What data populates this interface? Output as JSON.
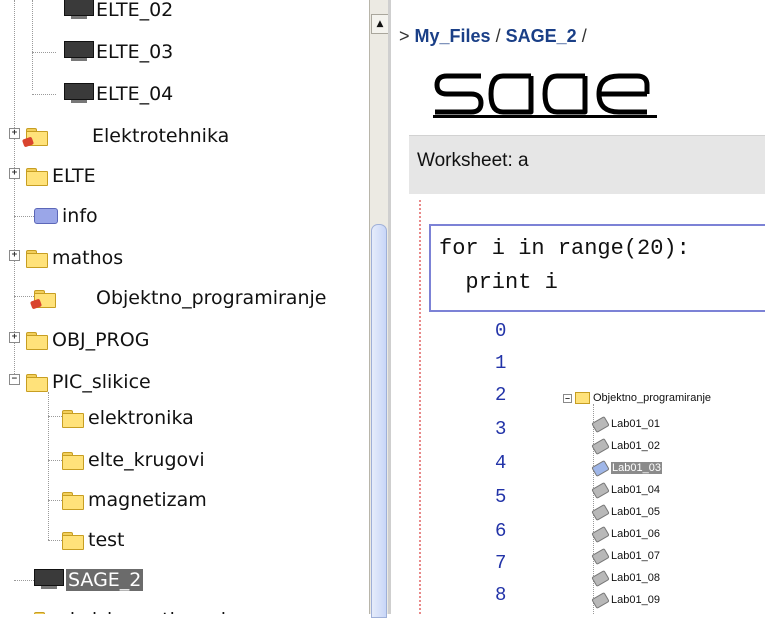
{
  "tree": {
    "items": [
      {
        "label": "ELTE_02",
        "icon": "monitor-icon"
      },
      {
        "label": "ELTE_03",
        "icon": "monitor-icon"
      },
      {
        "label": "ELTE_04",
        "icon": "monitor-icon"
      },
      {
        "label": "Elektrotehnika",
        "icon": "special-folder-icon",
        "expander": "+"
      },
      {
        "label": "ELTE",
        "icon": "folder-icon",
        "expander": "+"
      },
      {
        "label": "info",
        "icon": "info-icon"
      },
      {
        "label": "mathos",
        "icon": "folder-icon",
        "expander": "+"
      },
      {
        "label": "Objektno_programiranje",
        "icon": "special-folder-icon"
      },
      {
        "label": "OBJ_PROG",
        "icon": "folder-icon",
        "expander": "+"
      },
      {
        "label": "PIC_slikice",
        "icon": "open-folder-icon",
        "expander": "−"
      },
      {
        "label": "elektronika",
        "icon": "folder-icon"
      },
      {
        "label": "elte_krugovi",
        "icon": "folder-icon"
      },
      {
        "label": "magnetizam",
        "icon": "folder-icon"
      },
      {
        "label": "test",
        "icon": "folder-icon"
      },
      {
        "label": "SAGE_2",
        "icon": "monitor-icon",
        "selected": true
      },
      {
        "label": "skolsko_natjecanje",
        "icon": "folder-icon"
      }
    ]
  },
  "breadcrumb": {
    "prefix": ">",
    "folder": "My_Files",
    "sep": "/",
    "current": "SAGE_2",
    "trail": "/"
  },
  "logo": {
    "text": "sage"
  },
  "worksheet": {
    "label": "Worksheet: a"
  },
  "cell": {
    "line1": "for i in range(20):",
    "line2": "  print i"
  },
  "output": [
    "0",
    "1",
    "2",
    "3",
    "4",
    "5",
    "6",
    "7",
    "8"
  ],
  "mini_tree": {
    "root": "Objektno_programiranje",
    "expander": "−",
    "items": [
      {
        "label": "Lab01_01"
      },
      {
        "label": "Lab01_02"
      },
      {
        "label": "Lab01_03",
        "selected": true
      },
      {
        "label": "Lab01_04"
      },
      {
        "label": "Lab01_05"
      },
      {
        "label": "Lab01_06"
      },
      {
        "label": "Lab01_07"
      },
      {
        "label": "Lab01_08"
      },
      {
        "label": "Lab01_09"
      }
    ]
  },
  "scrollbar": {
    "up_arrow": "▲"
  },
  "colors": {
    "link": "#1a3f87",
    "output": "#2233a8",
    "cell_border": "#7c82d6"
  }
}
